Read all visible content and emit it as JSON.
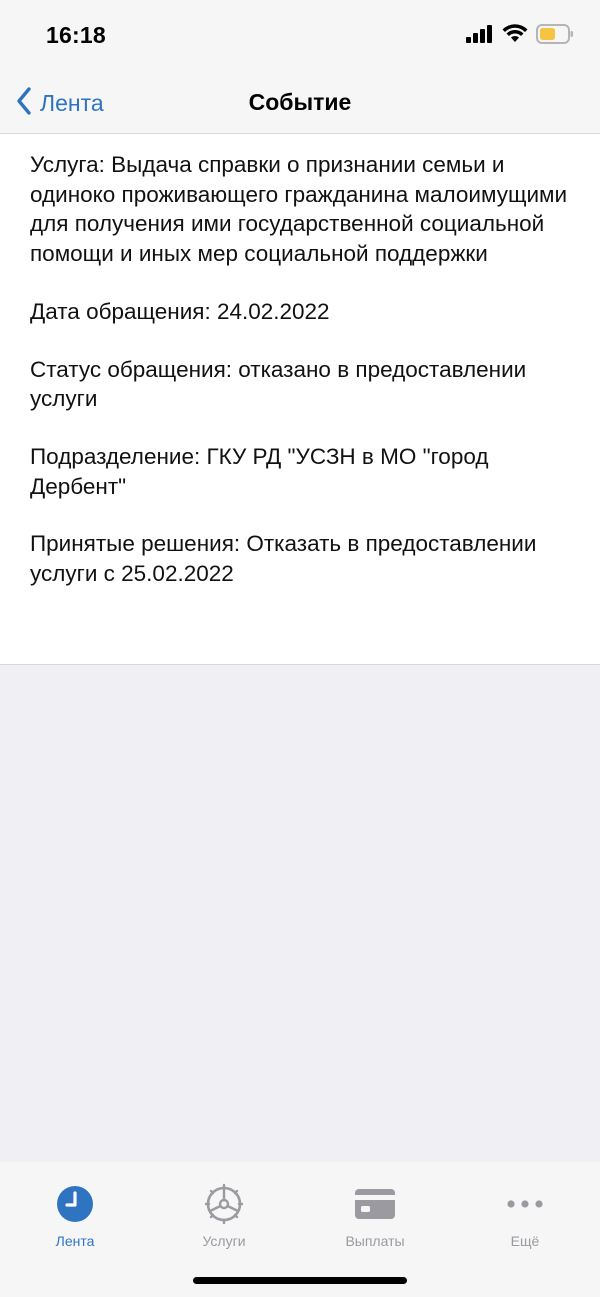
{
  "status_bar": {
    "time": "16:18",
    "icons": [
      "signal-icon",
      "wifi-icon",
      "battery-icon"
    ],
    "battery_color": "#f5c542"
  },
  "nav": {
    "back_label": "Лента",
    "title": "Событие"
  },
  "event": {
    "service": "Услуга: Выдача справки о признании семьи и одиноко проживающего гражданина малоимущими для получения ими государственной социальной помощи и иных мер социальной поддержки",
    "date": "Дата обращения: 24.02.2022",
    "status": "Статус обращения: отказано в предоставлении услуги",
    "department": "Подразделение: ГКУ РД \"УСЗН в МО \"город Дербент\"",
    "decision": "Принятые решения: Отказать в предоставлении услуги с 25.02.2022"
  },
  "tabs": [
    {
      "label": "Лента",
      "icon": "clock-icon",
      "active": true
    },
    {
      "label": "Услуги",
      "icon": "steering-wheel-icon",
      "active": false
    },
    {
      "label": "Выплаты",
      "icon": "card-icon",
      "active": false
    },
    {
      "label": "Ещё",
      "icon": "more-icon",
      "active": false
    }
  ],
  "colors": {
    "accent": "#2f74c0",
    "inactive": "#9a9aa0",
    "background": "#efeff4"
  }
}
